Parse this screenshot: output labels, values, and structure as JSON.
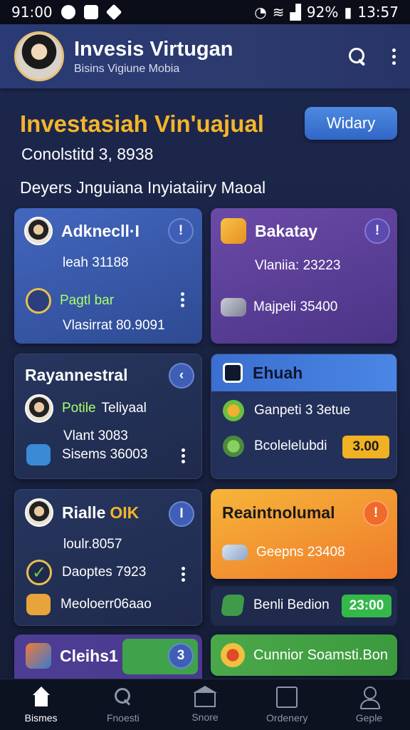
{
  "status_bar": {
    "time_left": "91:00",
    "battery": "92%",
    "clock": "13:57"
  },
  "header": {
    "title": "Invesis Virtugan",
    "subtitle": "Bisins Vigiune Mobia"
  },
  "hero": {
    "title": "Investasiah Vin'uajual",
    "pill": "Widary",
    "subtitle": "Conolstitd 3, 8938"
  },
  "section_title": "Deyers Jnguiana Inyiataiiry Maoal",
  "cards": [
    {
      "title": "Adknecll·I",
      "badge": "!",
      "line1": "leah 31188",
      "line2": "Pagtl bar",
      "line3": "Vlasirrat 80.9091"
    },
    {
      "title": "Bakatay",
      "badge": "!",
      "line1": "Vlaniia: 23223",
      "line2": "Majpeli 35400"
    },
    {
      "title": "Rayannestral",
      "badge": "‹",
      "line1": "Potile",
      "line1_extra": "Teliyaal",
      "line2": "Vlant 3083",
      "line3": "Sisems 36003"
    },
    {
      "title": "Ehuah",
      "line1": "Ganpeti 3 3etue",
      "line2": "Bcolelelubdi",
      "chip": "3.00"
    },
    {
      "title": "Rialle",
      "title_accent": "OIK",
      "badge": "I",
      "line1": "loulr.8057",
      "line2": "Daoptes 7923",
      "line3": "Meoloerr06aao"
    },
    {
      "title": "Reaintnolumal",
      "badge": "!",
      "line1": "Geepns 23408"
    },
    {
      "line1": "Benli Bedion",
      "chip": "23:00"
    },
    {
      "title": "Cleihs1",
      "badge": "3"
    },
    {
      "title": "Cunnior Soamsti.Bon"
    }
  ],
  "colors": {
    "accent_gold": "#f3b52a",
    "card_blue": "#3a5aa8",
    "card_purple": "#5a3f95",
    "card_navy": "#233059",
    "card_orange": "#f28a2e",
    "chip_green": "#35b84a",
    "chip_gold": "#f0b122"
  },
  "nav": [
    {
      "label": "Bismes",
      "icon": "home-icon",
      "active": true
    },
    {
      "label": "Fnoesti",
      "icon": "search-icon"
    },
    {
      "label": "Snore",
      "icon": "store-icon"
    },
    {
      "label": "Ordenery",
      "icon": "document-icon"
    },
    {
      "label": "Geple",
      "icon": "user-icon"
    }
  ]
}
